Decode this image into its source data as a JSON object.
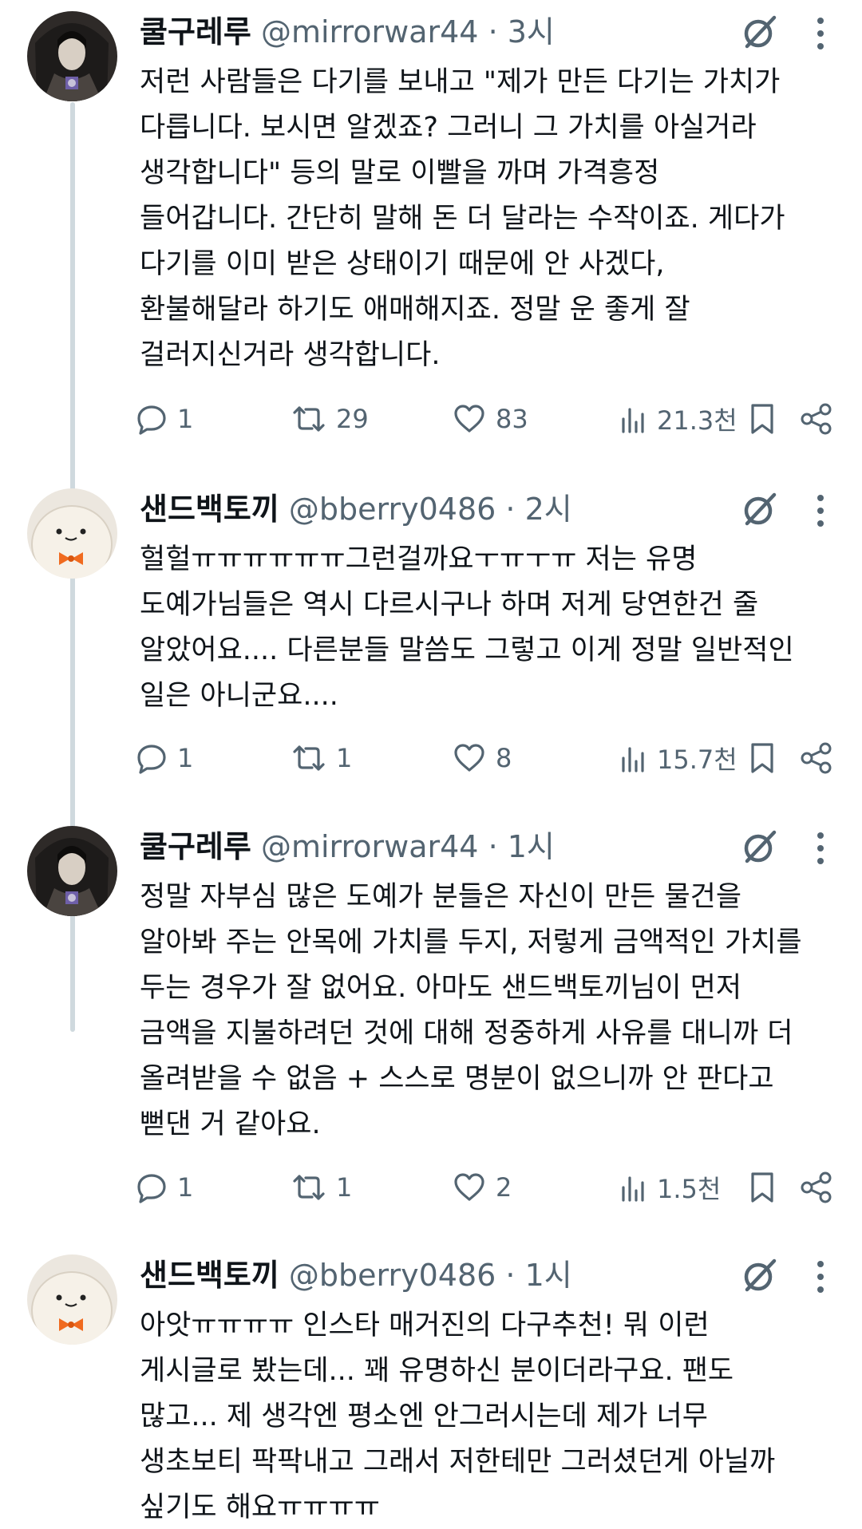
{
  "tweets": [
    {
      "name": "쿨구레루",
      "handle": "@mirrorwar44",
      "dot": "·",
      "time": "3시",
      "text": "저런 사람들은 다기를 보내고 \"제가 만든 다기는 가치가\n다릅니다. 보시면 알겠죠? 그러니 그 가치를 아실거라\n생각합니다\" 등의 말로 이빨을 까며 가격흥정\n들어갑니다. 간단히 말해 돈 더 달라는 수작이죠. 게다가\n다기를 이미 받은 상태이기 때문에 안 사겠다,\n환불해달라 하기도 애매해지죠. 정말 운 좋게 잘\n걸러지신거라 생각합니다.",
      "replies": "1",
      "reposts": "29",
      "likes": "83",
      "views": "21.3천"
    },
    {
      "name": "샌드백토끼",
      "handle": "@bberry0486",
      "dot": "·",
      "time": "2시",
      "text": "헐헐ㅠㅠㅠㅠㅠㅠ그런걸까요ㅜㅠㅜㅠ 저는 유명\n도예가님들은 역시 다르시구나 하며 저게 당연한건 줄\n알았어요.... 다른분들 말씀도 그렇고 이게 정말 일반적인\n일은 아니군요....",
      "replies": "1",
      "reposts": "1",
      "likes": "8",
      "views": "15.7천"
    },
    {
      "name": "쿨구레루",
      "handle": "@mirrorwar44",
      "dot": "·",
      "time": "1시",
      "text": "정말 자부심 많은 도예가 분들은 자신이 만든 물건을\n알아봐 주는 안목에 가치를 두지, 저렇게 금액적인 가치를\n두는 경우가 잘 없어요. 아마도 샌드백토끼님이 먼저\n금액을 지불하려던 것에 대해 정중하게 사유를 대니까 더\n올려받을 수 없음 + 스스로 명분이 없으니까 안 판다고\n뻗댄 거 같아요.",
      "replies": "1",
      "reposts": "1",
      "likes": "2",
      "views": "1.5천"
    },
    {
      "name": "샌드백토끼",
      "handle": "@bberry0486",
      "dot": "·",
      "time": "1시",
      "text": "아앗ㅠㅠㅠㅠ 인스타 매거진의 다구추천! 뭐 이런\n게시글로 봤는데... 꽤 유명하신 분이더라구요. 팬도\n많고... 제 생각엔 평소엔 안그러시는데 제가 너무\n생초보티 팍팍내고 그래서 저한테만 그러셨던게 아닐까\n싶기도 해요ㅠㅠㅠㅠ"
    }
  ],
  "icons": {
    "grok": "grok-slash-icon",
    "more": "more-vertical-icon",
    "reply": "reply-icon",
    "repost": "repost-icon",
    "like": "heart-icon",
    "views": "views-bar-chart-icon",
    "bookmark": "bookmark-icon",
    "share": "share-icon"
  },
  "colors": {
    "text": "#0f1419",
    "secondary": "#536471",
    "thread_line": "#cfd9de"
  }
}
